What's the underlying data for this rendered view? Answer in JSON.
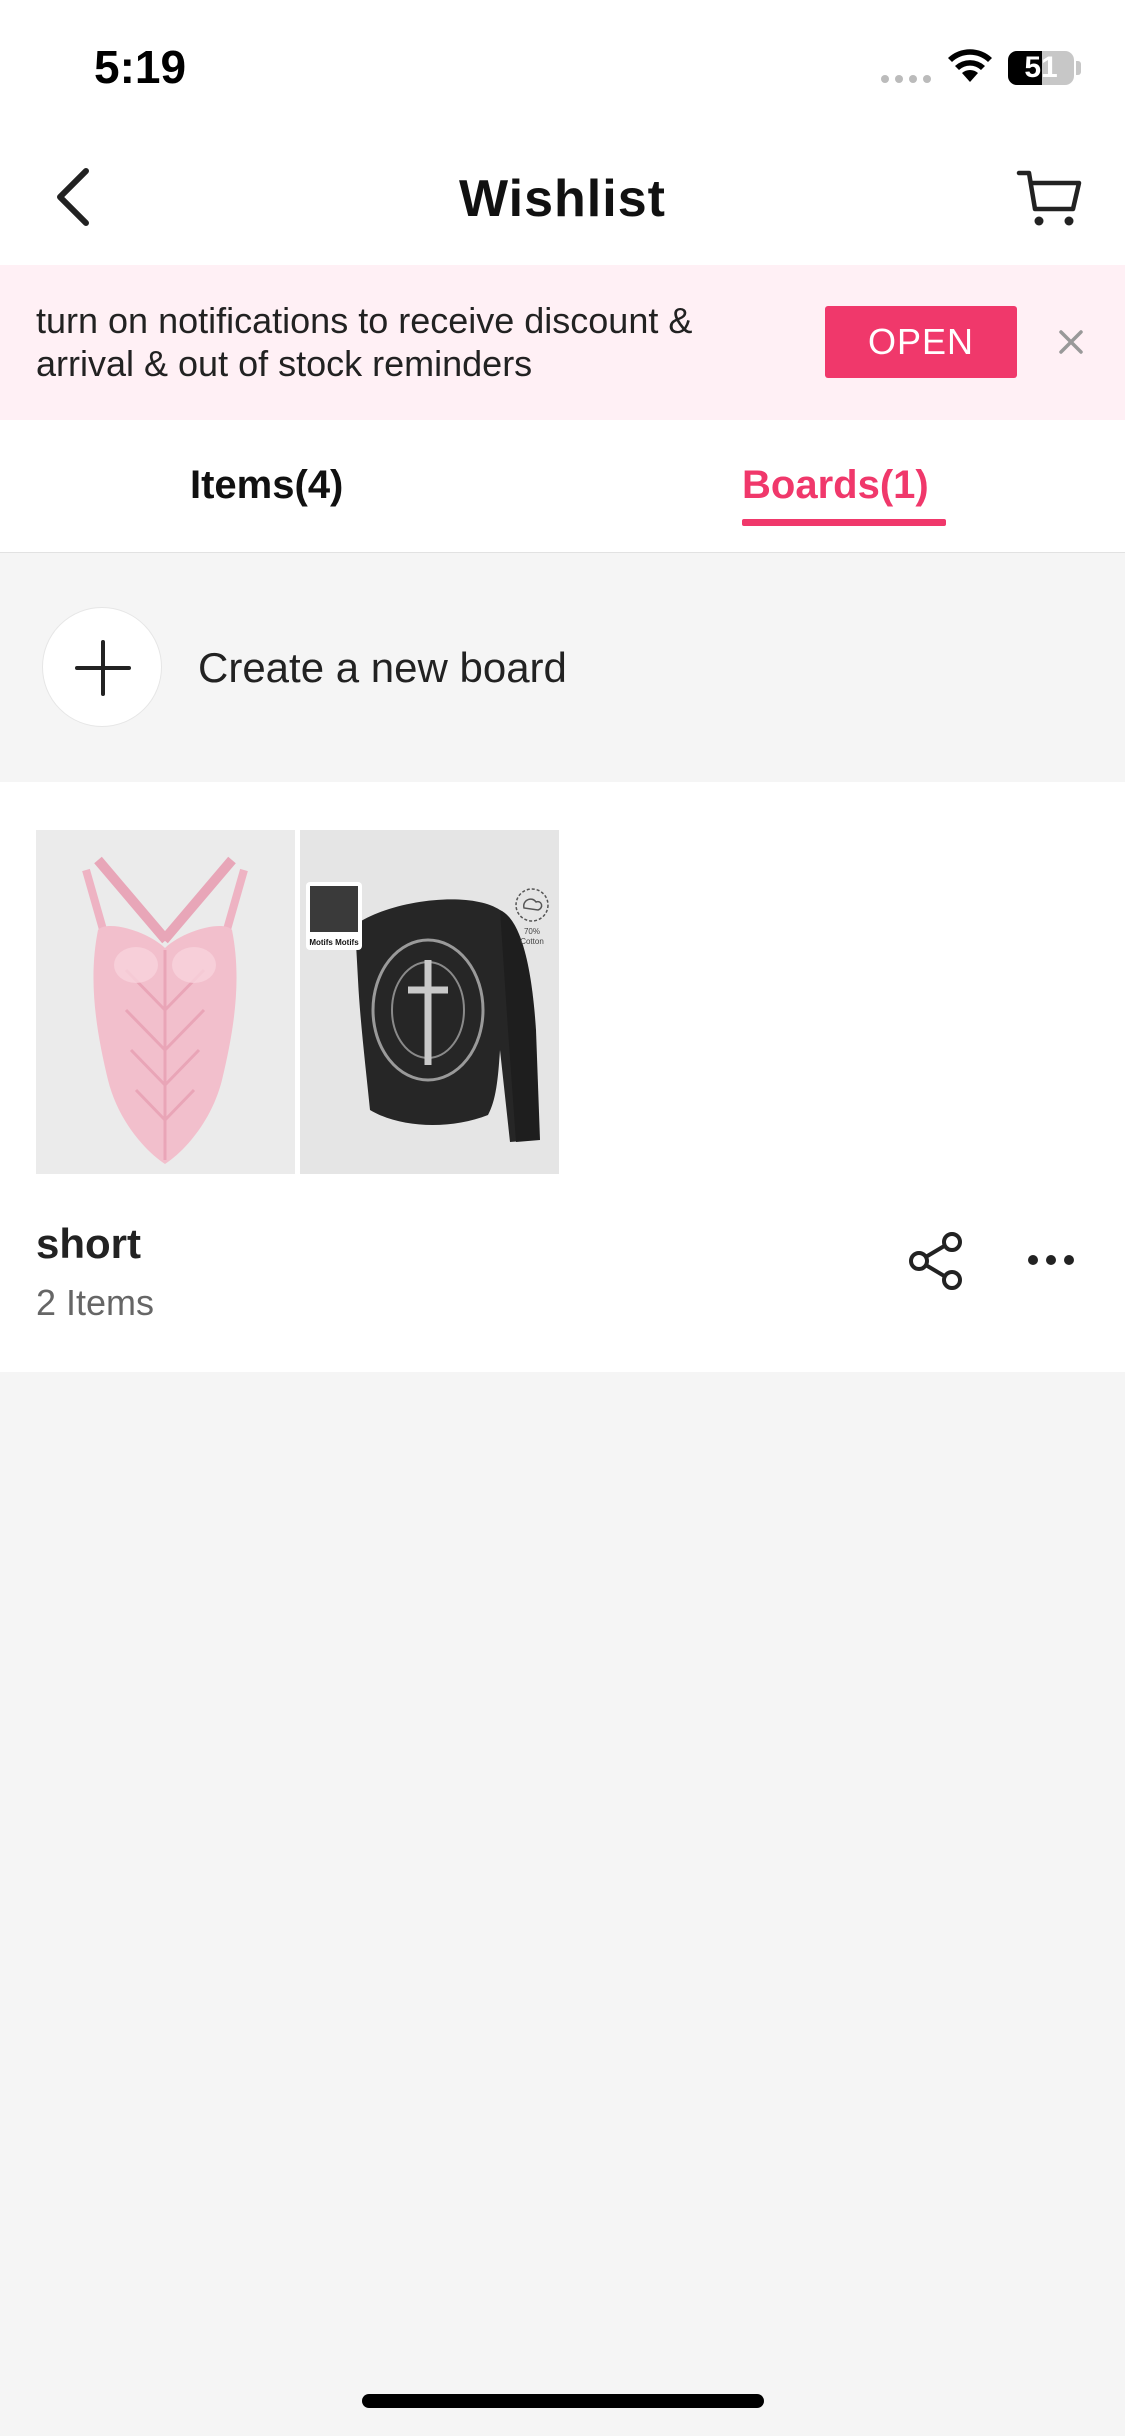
{
  "status_bar": {
    "time": "5:19",
    "battery": "51",
    "battery_level": 0.51
  },
  "header": {
    "title": "Wishlist",
    "back_icon": "chevron-left-icon",
    "cart_icon": "cart-icon"
  },
  "notification": {
    "message": "turn on notifications to receive discount & arrival & out of stock reminders",
    "open_label": "OPEN",
    "close_icon": "close-icon"
  },
  "tabs": [
    {
      "label": "Items(4)",
      "active": false
    },
    {
      "label": "Boards(1)",
      "active": true
    }
  ],
  "create_board": {
    "label": "Create a new board",
    "icon": "plus-icon"
  },
  "board": {
    "name": "short",
    "count": "2 Items",
    "thumbnails": [
      {
        "desc": "pink lace bodysuit"
      },
      {
        "desc": "black graphic off-shoulder top",
        "badge_text": "Motifs Motifs",
        "material_text": "70% Cotton"
      }
    ],
    "share_icon": "share-icon",
    "more_icon": "more-icon"
  },
  "colors": {
    "accent": "#f0386b",
    "banner_bg": "#fff0f5",
    "page_bg": "#f5f5f5"
  }
}
